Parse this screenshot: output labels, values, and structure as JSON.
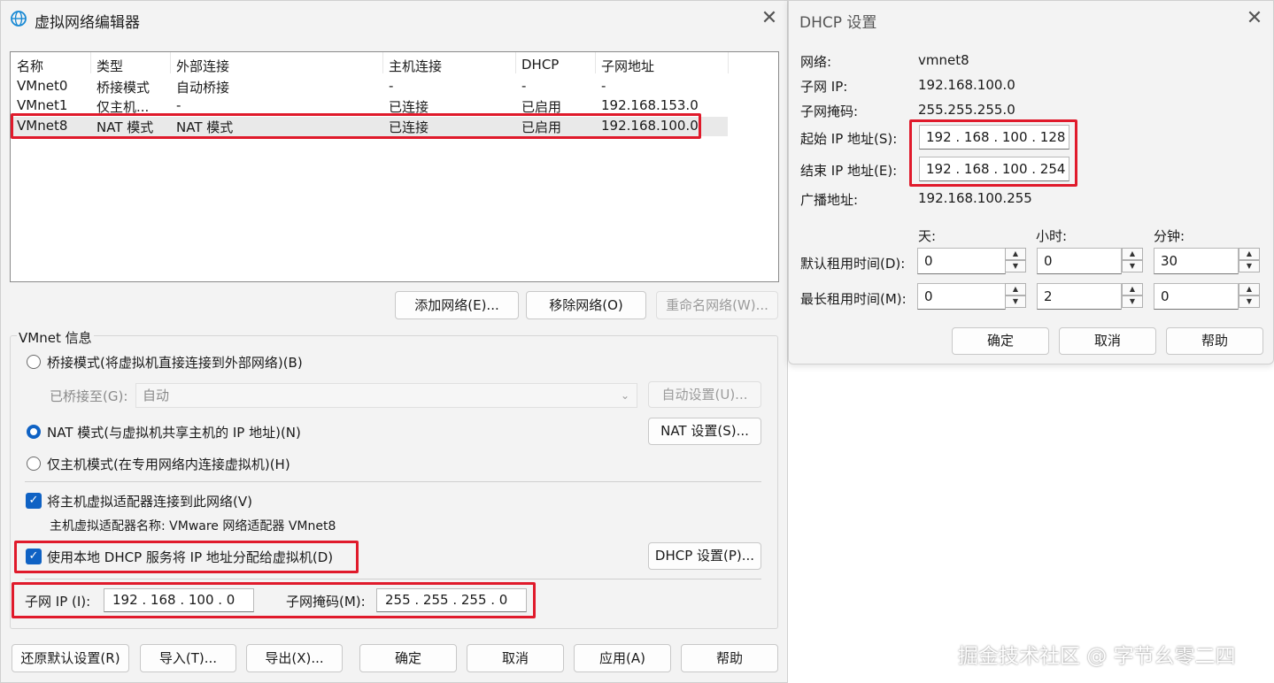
{
  "editor": {
    "title": "虚拟网络编辑器",
    "columns": [
      "名称",
      "类型",
      "外部连接",
      "主机连接",
      "DHCP",
      "子网地址"
    ],
    "rows": [
      [
        "VMnet0",
        "桥接模式",
        "自动桥接",
        "-",
        "-",
        "-"
      ],
      [
        "VMnet1",
        "仅主机...",
        "-",
        "已连接",
        "已启用",
        "192.168.153.0"
      ],
      [
        "VMnet8",
        "NAT 模式",
        "NAT 模式",
        "已连接",
        "已启用",
        "192.168.100.0"
      ]
    ],
    "add_network": "添加网络(E)...",
    "remove_network": "移除网络(O)",
    "rename_network": "重命名网络(W)...",
    "info_title": "VMnet 信息",
    "bridged_radio": "桥接模式(将虚拟机直接连接到外部网络)(B)",
    "bridged_to_label": "已桥接至(G):",
    "bridged_to_value": "自动",
    "auto_settings": "自动设置(U)...",
    "nat_radio": "NAT 模式(与虚拟机共享主机的 IP 地址)(N)",
    "nat_settings": "NAT 设置(S)...",
    "hostonly_radio": "仅主机模式(在专用网络内连接虚拟机)(H)",
    "connect_adapter_check": "将主机虚拟适配器连接到此网络(V)",
    "adapter_name": "主机虚拟适配器名称: VMware 网络适配器 VMnet8",
    "dhcp_check": "使用本地 DHCP 服务将 IP 地址分配给虚拟机(D)",
    "dhcp_settings": "DHCP 设置(P)...",
    "subnet_ip_label": "子网 IP (I):",
    "subnet_ip_value": "192 . 168 . 100 .  0",
    "subnet_mask_label": "子网掩码(M):",
    "subnet_mask_value": "255 . 255 . 255 .  0",
    "restore_defaults": "还原默认设置(R)",
    "import": "导入(T)...",
    "export": "导出(X)...",
    "ok": "确定",
    "cancel": "取消",
    "apply": "应用(A)",
    "help": "帮助"
  },
  "dhcp": {
    "title": "DHCP 设置",
    "network_label": "网络:",
    "network_value": "vmnet8",
    "subnet_ip_label": "子网 IP:",
    "subnet_ip_value": "192.168.100.0",
    "subnet_mask_label": "子网掩码:",
    "subnet_mask_value": "255.255.255.0",
    "start_ip_label": "起始 IP 地址(S):",
    "start_ip_value": "192 . 168 . 100 . 128",
    "end_ip_label": "结束 IP 地址(E):",
    "end_ip_value": "192 . 168 . 100 . 254",
    "broadcast_label": "广播地址:",
    "broadcast_value": "192.168.100.255",
    "days_label": "天:",
    "hours_label": "小时:",
    "minutes_label": "分钟:",
    "default_lease_label": "默认租用时间(D):",
    "default_lease": [
      "0",
      "0",
      "30"
    ],
    "max_lease_label": "最长租用时间(M):",
    "max_lease": [
      "0",
      "2",
      "0"
    ],
    "ok": "确定",
    "cancel": "取消",
    "help": "帮助"
  },
  "watermark": "掘金技术社区 @ 字节幺零二四",
  "colors": {
    "accent": "#0f62c4",
    "highlight_box": "#e01a2b"
  }
}
